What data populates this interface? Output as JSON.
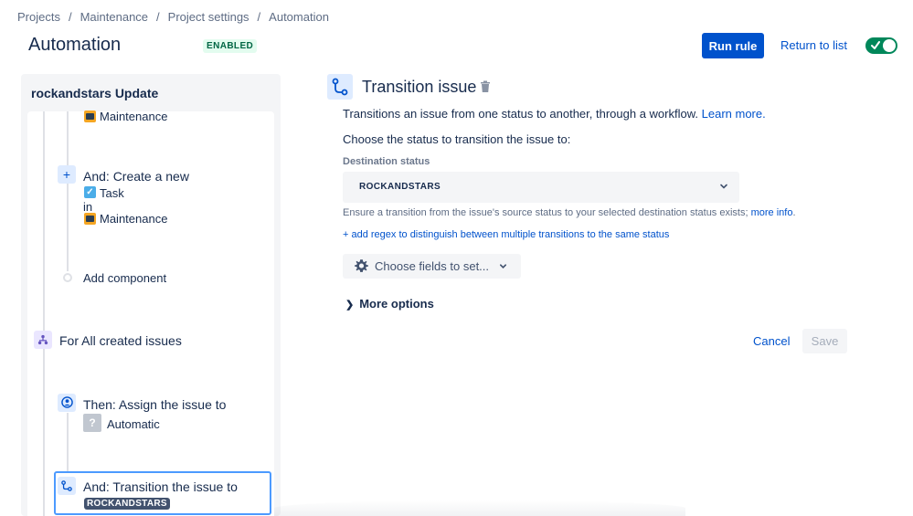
{
  "breadcrumb": {
    "items": [
      "Projects",
      "Maintenance",
      "Project settings",
      "Automation"
    ],
    "separator": "/"
  },
  "header": {
    "title": "Automation",
    "status_badge": "ENABLED",
    "run_rule_label": "Run rule",
    "return_label": "Return to list",
    "rule_enabled": true
  },
  "rule": {
    "name": "rockandstars Update",
    "top_item_project": "Maintenance",
    "create": {
      "title": "And: Create a new",
      "issue_type": "Task",
      "in_label": "in",
      "project": "Maintenance"
    },
    "add_component": "Add component",
    "branch": {
      "title": "For All created issues",
      "assign": {
        "title": "Then: Assign the issue to",
        "avatar_glyph": "?",
        "value": "Automatic"
      },
      "transition": {
        "title": "And: Transition the issue to",
        "status": "ROCKANDSTARS"
      }
    }
  },
  "detail": {
    "title": "Transition issue",
    "description": "Transitions an issue from one status to another, through a workflow.",
    "learn_more": "Learn more.",
    "choose_prompt": "Choose the status to transition the issue to:",
    "destination_label": "Destination status",
    "destination_value": "ROCKANDSTARS",
    "hint": "Ensure a transition from the issue's source status to your selected destination status exists;",
    "hint_link": "more info",
    "hint_end": ".",
    "regex_link": "+ add regex to distinguish between multiple transitions to the same status",
    "fields_button": "Choose fields to set...",
    "more_options": "More options",
    "cancel_label": "Cancel",
    "save_label": "Save"
  },
  "colors": {
    "primary": "#0052cc",
    "toggle_on": "#00875a",
    "selected_border": "#4c9aff"
  }
}
